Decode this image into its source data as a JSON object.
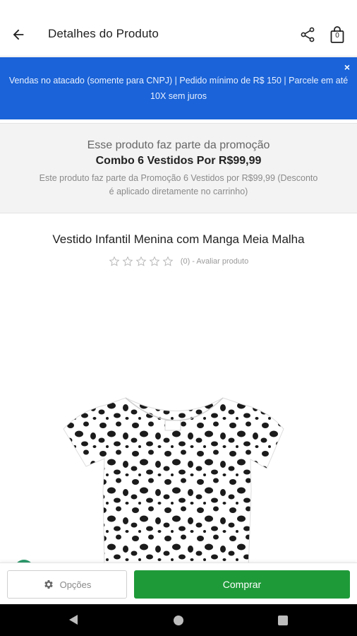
{
  "header": {
    "title": "Detalhes do Produto",
    "cart_count": "0"
  },
  "banner": {
    "text": "Vendas no atacado (somente para CNPJ) |  Pedido mínimo de R$ 150 | Parcele em até 10X sem juros",
    "close": "×"
  },
  "promo": {
    "line1": "Esse produto faz parte da promoção",
    "line2": "Combo 6 Vestidos Por R$99,99",
    "line3": "Este produto faz parte da Promoção 6 Vestidos por R$99,99 (Desconto é aplicado diretamente no carrinho)"
  },
  "product": {
    "title": "Vestido Infantil Menina com Manga Meia Malha",
    "rating_text": "(0) - Avaliar produto",
    "rating_value": 0,
    "rating_max": 5
  },
  "actions": {
    "options_label": "Opções",
    "buy_label": "Comprar"
  },
  "colors": {
    "banner": "#1a63d8",
    "buy": "#1f9a39"
  },
  "icons": {
    "back": "arrow-left-icon",
    "share": "share-icon",
    "cart": "shopping-bag-icon",
    "options": "gear-icon"
  }
}
